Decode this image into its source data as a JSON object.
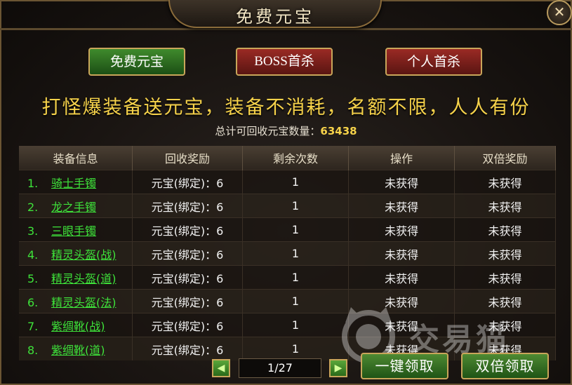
{
  "window": {
    "title": "免费元宝",
    "close_icon": "close-icon"
  },
  "tabs": [
    {
      "label": "免费元宝"
    },
    {
      "label": "BOSS首杀"
    },
    {
      "label": "个人首杀"
    }
  ],
  "slogan": "打怪爆装备送元宝，装备不消耗，名额不限，人人有份",
  "total": {
    "label": "总计可回收元宝数量：",
    "value": "63438"
  },
  "table": {
    "headers": [
      "装备信息",
      "回收奖励",
      "剩余次数",
      "操作",
      "双倍奖励"
    ],
    "rows": [
      {
        "index": "1.",
        "item": "骑士手镯",
        "reward": "元宝(绑定)：6",
        "remaining": "1",
        "action": "未获得",
        "double": "未获得"
      },
      {
        "index": "2.",
        "item": "龙之手镯",
        "reward": "元宝(绑定)：6",
        "remaining": "1",
        "action": "未获得",
        "double": "未获得"
      },
      {
        "index": "3.",
        "item": "三眼手镯",
        "reward": "元宝(绑定)：6",
        "remaining": "1",
        "action": "未获得",
        "double": "未获得"
      },
      {
        "index": "4.",
        "item": "精灵头盔(战)",
        "reward": "元宝(绑定)：6",
        "remaining": "1",
        "action": "未获得",
        "double": "未获得"
      },
      {
        "index": "5.",
        "item": "精灵头盔(道)",
        "reward": "元宝(绑定)：6",
        "remaining": "1",
        "action": "未获得",
        "double": "未获得"
      },
      {
        "index": "6.",
        "item": "精灵头盔(法)",
        "reward": "元宝(绑定)：6",
        "remaining": "1",
        "action": "未获得",
        "double": "未获得"
      },
      {
        "index": "7.",
        "item": "紫绸靴(战)",
        "reward": "元宝(绑定)：6",
        "remaining": "1",
        "action": "未获得",
        "double": "未获得"
      },
      {
        "index": "8.",
        "item": "紫绸靴(道)",
        "reward": "元宝(绑定)：6",
        "remaining": "1",
        "action": "未获得",
        "double": "未获得"
      }
    ]
  },
  "pager": {
    "page": "1/27"
  },
  "buttons": {
    "claim_all": "一键领取",
    "claim_double": "双倍领取"
  },
  "watermark": {
    "text": "交易猫"
  },
  "colors": {
    "accent_gold": "#f6d24a",
    "item_green": "#3ee23a",
    "border_gold": "#c9a65a"
  }
}
